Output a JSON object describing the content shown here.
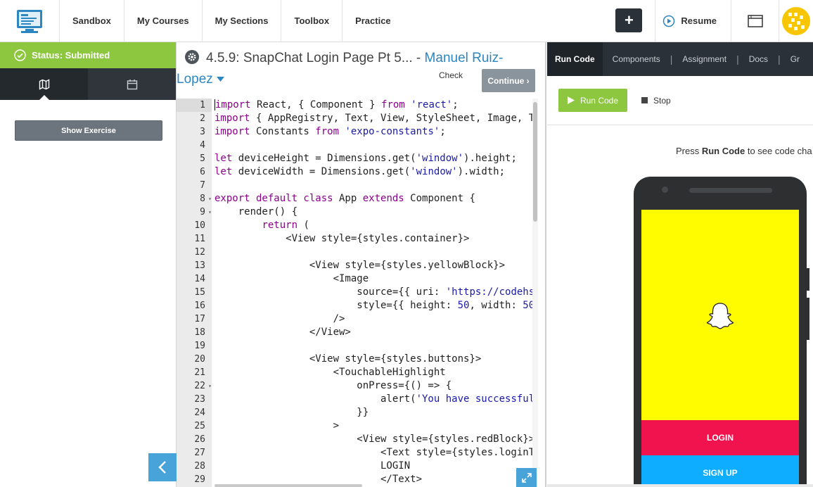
{
  "nav": {
    "items": [
      "Sandbox",
      "My Courses",
      "My Sections",
      "Toolbox",
      "Practice"
    ],
    "plus_label": "+",
    "resume_label": "Resume"
  },
  "left": {
    "status": "Status: Submitted",
    "show_exercise": "Show Exercise"
  },
  "exercise": {
    "title": "4.5.9: SnapChat Login Page Pt 5...",
    "separator": " - ",
    "author": "Manuel Ruiz-Lopez",
    "check_label": "Check",
    "continue_label": "Continue"
  },
  "editor": {
    "line_numbers": [
      "1",
      "2",
      "3",
      "4",
      "5",
      "6",
      "7",
      "8",
      "9",
      "10",
      "11",
      "12",
      "13",
      "14",
      "15",
      "16",
      "17",
      "18",
      "19",
      "20",
      "21",
      "22",
      "23",
      "24",
      "25",
      "26",
      "27",
      "28",
      "29"
    ],
    "folds": [
      "",
      "",
      "",
      "",
      "",
      "",
      "",
      "8",
      "9",
      "",
      "",
      "",
      "",
      "",
      "",
      "",
      "",
      "",
      "",
      "",
      "",
      "22",
      "",
      "",
      "",
      "",
      "",
      "",
      ""
    ]
  },
  "right": {
    "tabs": [
      "Run Code",
      "Components",
      "Assignment",
      "Docs",
      "Gr"
    ],
    "run_label": "Run Code",
    "stop_label": "Stop",
    "press_prefix": "Press ",
    "press_bold": "Run Code",
    "press_suffix": " to see code cha",
    "login_label": "LOGIN",
    "signup_label": "SIGN UP"
  },
  "colors": {
    "status_green": "#8dc63f",
    "link_blue": "#2e86c1",
    "snap_yellow": "#fffc00",
    "login_red": "#f0134d",
    "signup_blue": "#0eadff"
  }
}
